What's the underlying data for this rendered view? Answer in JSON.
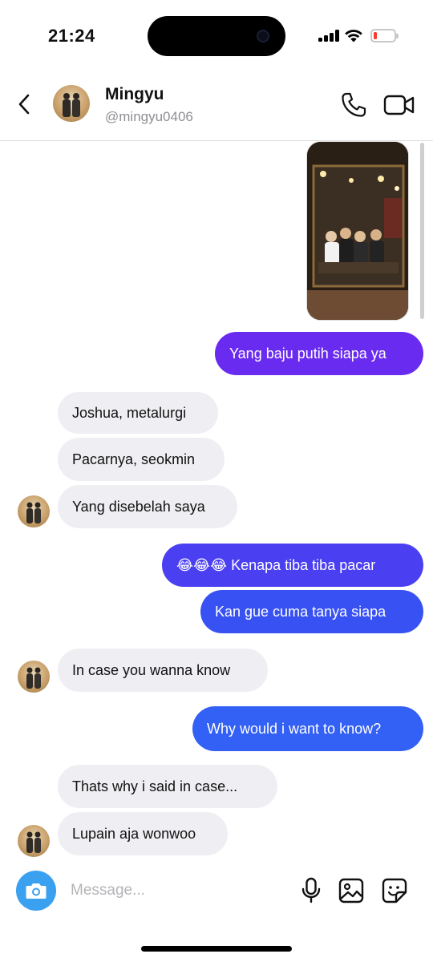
{
  "status_bar": {
    "time": "21:24"
  },
  "header": {
    "name": "Mingyu",
    "handle": "@mingyu0406"
  },
  "icons": {
    "back": "chevron-left-icon",
    "call": "phone-icon",
    "video": "video-camera-icon",
    "camera": "camera-icon",
    "mic": "microphone-icon",
    "gallery": "image-icon",
    "sticker": "sticker-icon"
  },
  "colors": {
    "outgoing_purple": "#6a2bf0",
    "outgoing_blue": "#3751f3",
    "incoming_gray": "#efeff3",
    "camera_button": "#3aa0f0"
  },
  "messages": [
    {
      "sender": "me",
      "type": "photo"
    },
    {
      "sender": "me",
      "text": "Yang baju putih siapa ya"
    },
    {
      "sender": "them",
      "text": "Joshua, metalurgi"
    },
    {
      "sender": "them",
      "text": "Pacarnya, seokmin"
    },
    {
      "sender": "them",
      "text": "Yang disebelah saya"
    },
    {
      "sender": "me",
      "text": "😂😂😂 Kenapa tiba tiba pacar"
    },
    {
      "sender": "me",
      "text": "Kan gue cuma tanya siapa"
    },
    {
      "sender": "them",
      "text": "In case you wanna know"
    },
    {
      "sender": "me",
      "text": "Why would i want to know?"
    },
    {
      "sender": "them",
      "text": "Thats why i said in case..."
    },
    {
      "sender": "them",
      "text": "Lupain aja wonwoo"
    }
  ],
  "composer": {
    "placeholder": "Message..."
  }
}
